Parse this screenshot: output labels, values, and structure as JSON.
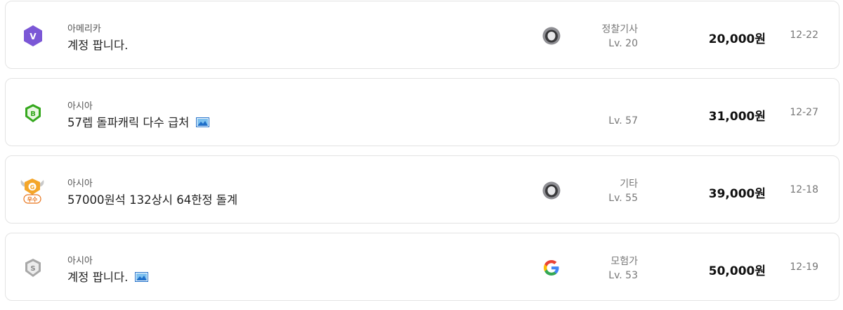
{
  "listings": [
    {
      "badge_icon": "v-grade-purple-hexagon-icon",
      "server": "아메리카",
      "title": "계정 팝니다.",
      "has_image": false,
      "login_icon": "default-account-icon",
      "class": "정찰기사",
      "level": "Lv. 20",
      "price": "20,000원",
      "date": "12-22"
    },
    {
      "badge_icon": "b-grade-green-shield-icon",
      "server": "아시아",
      "title": "57렙 돌파캐릭 다수 급처",
      "has_image": true,
      "login_icon": "",
      "class": "",
      "level": "Lv. 57",
      "price": "31,000원",
      "date": "12-27"
    },
    {
      "badge_icon": "g-grade-excellent-horned-badge-icon",
      "badge_text": "우수",
      "server": "아시아",
      "title": "57000원석 132상시 64한정 돌계",
      "has_image": false,
      "login_icon": "default-account-icon",
      "class": "기타",
      "level": "Lv. 55",
      "price": "39,000원",
      "date": "12-18"
    },
    {
      "badge_icon": "s-grade-gray-shield-icon",
      "server": "아시아",
      "title": "계정 팝니다.",
      "has_image": true,
      "login_icon": "google-icon",
      "class": "모험가",
      "level": "Lv. 53",
      "price": "50,000원",
      "date": "12-19"
    }
  ],
  "colors": {
    "v_badge": "#7b57d6",
    "b_badge": "#35a81e",
    "g_badge": "#f4a62a",
    "s_badge": "#a8a8a8",
    "price_text": "#111111",
    "meta_text": "#777777"
  }
}
